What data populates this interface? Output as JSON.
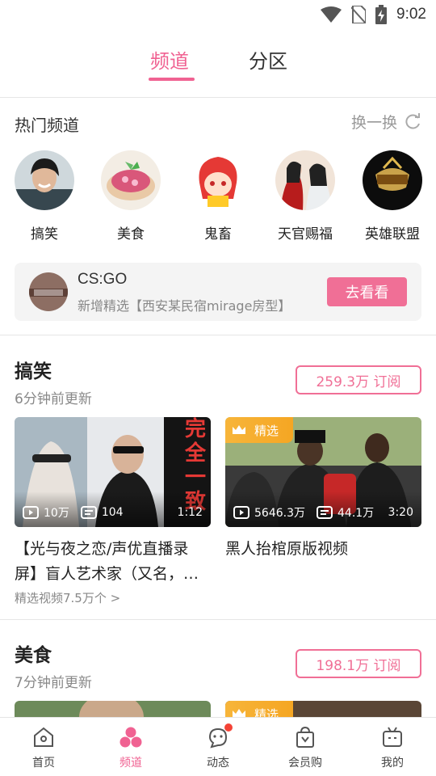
{
  "status_bar": {
    "time": "9:02"
  },
  "top_tabs": [
    {
      "label": "频道",
      "active": true
    },
    {
      "label": "分区",
      "active": false
    }
  ],
  "hot_channels": {
    "title": "热门频道",
    "refresh_label": "换一换",
    "items": [
      {
        "label": "搞笑"
      },
      {
        "label": "美食"
      },
      {
        "label": "鬼畜"
      },
      {
        "label": "天官赐福"
      },
      {
        "label": "英雄联盟"
      }
    ]
  },
  "featured": {
    "title": "CS:GO",
    "subtitle": "新增精选【西安某民宿mirage房型】",
    "button": "去看看"
  },
  "sections": [
    {
      "title": "搞笑",
      "updated": "6分钟前更新",
      "subscribe": "259.3万 订阅",
      "videos": [
        {
          "title": "【光与夜之恋/声优直播录屏】盲人艺术家（又名，…",
          "views": "10万",
          "danmaku": "104",
          "duration": "1:12",
          "badge": "",
          "thumb_text": "完全一致"
        },
        {
          "title": "黑人抬棺原版视频",
          "views": "5646.3万",
          "danmaku": "44.1万",
          "duration": "3:20",
          "badge": "精选"
        }
      ],
      "more": "精选视频7.5万个 >"
    },
    {
      "title": "美食",
      "updated": "7分钟前更新",
      "subscribe": "198.1万 订阅",
      "videos": [
        {
          "badge": ""
        },
        {
          "badge": "精选"
        }
      ]
    }
  ],
  "bottom_nav": [
    {
      "label": "首页",
      "icon": "home-icon"
    },
    {
      "label": "频道",
      "icon": "channel-icon",
      "active": true
    },
    {
      "label": "动态",
      "icon": "feed-icon",
      "dot": true
    },
    {
      "label": "会员购",
      "icon": "shop-icon"
    },
    {
      "label": "我的",
      "icon": "tv-icon"
    }
  ],
  "colors": {
    "accent": "#f06292",
    "badge": "#f5a623"
  }
}
